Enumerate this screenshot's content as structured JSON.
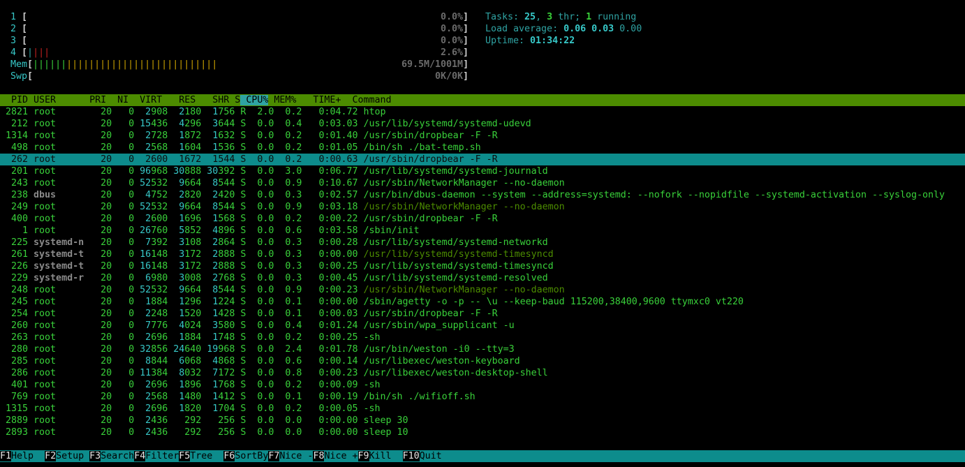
{
  "meters": {
    "cpus": [
      {
        "label": "1",
        "value": "0.0%",
        "bar": ""
      },
      {
        "label": "2",
        "value": "0.0%",
        "bar": ""
      },
      {
        "label": "3",
        "value": "0.0%",
        "bar": ""
      },
      {
        "label": "4",
        "value": "2.6%",
        "bar": "|||"
      }
    ],
    "mem": {
      "label": "Mem",
      "value": "69.5M/1001M",
      "bar_blue": "||||||",
      "bar_yellow": "|||||||||||||||||||||||||||"
    },
    "swp": {
      "label": "Swp",
      "value": "0K/0K"
    }
  },
  "summary": {
    "tasks_label": "Tasks: ",
    "tasks": "25",
    "thr": "3",
    "thr_label": " thr; ",
    "running": "1",
    "running_label": " running",
    "load_label": "Load average: ",
    "load1": "0.06",
    "load5": "0.03",
    "load15": "0.00",
    "uptime_label": "Uptime: ",
    "uptime": "01:34:22"
  },
  "header": {
    "pid": "  PID",
    "user": " USER     ",
    "pri": " PRI",
    "ni": "  NI",
    "virt": "  VIRT",
    "res": "   RES",
    "shr": "   SHR",
    "s": " S",
    "cpu": " CPU%",
    "mem": " MEM%",
    "time": "   TIME+ ",
    "command": " Command"
  },
  "processes": [
    {
      "pid": "2821",
      "user": "root",
      "pri": "20",
      "ni": "0",
      "virt": "2908",
      "res": "2180",
      "shr": "1756",
      "s": "R",
      "cpu": "2.0",
      "mem": "0.2",
      "time": "0:04.72",
      "command": "htop",
      "thread": false,
      "selected": false
    },
    {
      "pid": "212",
      "user": "root",
      "pri": "20",
      "ni": "0",
      "virt": "15436",
      "res": "4296",
      "shr": "3644",
      "s": "S",
      "cpu": "0.0",
      "mem": "0.4",
      "time": "0:03.03",
      "command": "/usr/lib/systemd/systemd-udevd",
      "thread": false,
      "selected": false
    },
    {
      "pid": "1314",
      "user": "root",
      "pri": "20",
      "ni": "0",
      "virt": "2728",
      "res": "1872",
      "shr": "1632",
      "s": "S",
      "cpu": "0.0",
      "mem": "0.2",
      "time": "0:01.40",
      "command": "/usr/sbin/dropbear -F -R",
      "thread": false,
      "selected": false
    },
    {
      "pid": "498",
      "user": "root",
      "pri": "20",
      "ni": "0",
      "virt": "2568",
      "res": "1604",
      "shr": "1536",
      "s": "S",
      "cpu": "0.0",
      "mem": "0.2",
      "time": "0:01.05",
      "command": "/bin/sh ./bat-temp.sh",
      "thread": false,
      "selected": false
    },
    {
      "pid": "262",
      "user": "root",
      "pri": "20",
      "ni": "0",
      "virt": "2600",
      "res": "1672",
      "shr": "1544",
      "s": "S",
      "cpu": "0.0",
      "mem": "0.2",
      "time": "0:00.63",
      "command": "/usr/sbin/dropbear -F -R",
      "thread": false,
      "selected": true
    },
    {
      "pid": "201",
      "user": "root",
      "pri": "20",
      "ni": "0",
      "virt": "96968",
      "res": "30888",
      "shr": "30392",
      "s": "S",
      "cpu": "0.0",
      "mem": "3.0",
      "time": "0:06.77",
      "command": "/usr/lib/systemd/systemd-journald",
      "thread": false,
      "selected": false
    },
    {
      "pid": "243",
      "user": "root",
      "pri": "20",
      "ni": "0",
      "virt": "52532",
      "res": "9664",
      "shr": "8544",
      "s": "S",
      "cpu": "0.0",
      "mem": "0.9",
      "time": "0:10.67",
      "command": "/usr/sbin/NetworkManager --no-daemon",
      "thread": false,
      "selected": false
    },
    {
      "pid": "238",
      "user": "dbus",
      "pri": "20",
      "ni": "0",
      "virt": "4752",
      "res": "2820",
      "shr": "2420",
      "s": "S",
      "cpu": "0.0",
      "mem": "0.3",
      "time": "0:02.57",
      "command": "/usr/bin/dbus-daemon --system --address=systemd: --nofork --nopidfile --systemd-activation --syslog-only",
      "thread": false,
      "selected": false
    },
    {
      "pid": "249",
      "user": "root",
      "pri": "20",
      "ni": "0",
      "virt": "52532",
      "res": "9664",
      "shr": "8544",
      "s": "S",
      "cpu": "0.0",
      "mem": "0.9",
      "time": "0:03.18",
      "command": "/usr/sbin/NetworkManager --no-daemon",
      "thread": true,
      "selected": false
    },
    {
      "pid": "400",
      "user": "root",
      "pri": "20",
      "ni": "0",
      "virt": "2600",
      "res": "1696",
      "shr": "1568",
      "s": "S",
      "cpu": "0.0",
      "mem": "0.2",
      "time": "0:00.22",
      "command": "/usr/sbin/dropbear -F -R",
      "thread": false,
      "selected": false
    },
    {
      "pid": "1",
      "user": "root",
      "pri": "20",
      "ni": "0",
      "virt": "26760",
      "res": "5852",
      "shr": "4896",
      "s": "S",
      "cpu": "0.0",
      "mem": "0.6",
      "time": "0:03.58",
      "command": "/sbin/init",
      "thread": false,
      "selected": false
    },
    {
      "pid": "225",
      "user": "systemd-n",
      "pri": "20",
      "ni": "0",
      "virt": "7392",
      "res": "3108",
      "shr": "2864",
      "s": "S",
      "cpu": "0.0",
      "mem": "0.3",
      "time": "0:00.28",
      "command": "/usr/lib/systemd/systemd-networkd",
      "thread": false,
      "selected": false
    },
    {
      "pid": "261",
      "user": "systemd-t",
      "pri": "20",
      "ni": "0",
      "virt": "16148",
      "res": "3172",
      "shr": "2888",
      "s": "S",
      "cpu": "0.0",
      "mem": "0.3",
      "time": "0:00.00",
      "command": "/usr/lib/systemd/systemd-timesyncd",
      "thread": true,
      "selected": false
    },
    {
      "pid": "226",
      "user": "systemd-t",
      "pri": "20",
      "ni": "0",
      "virt": "16148",
      "res": "3172",
      "shr": "2888",
      "s": "S",
      "cpu": "0.0",
      "mem": "0.3",
      "time": "0:00.25",
      "command": "/usr/lib/systemd/systemd-timesyncd",
      "thread": false,
      "selected": false
    },
    {
      "pid": "229",
      "user": "systemd-r",
      "pri": "20",
      "ni": "0",
      "virt": "6980",
      "res": "3008",
      "shr": "2768",
      "s": "S",
      "cpu": "0.0",
      "mem": "0.3",
      "time": "0:00.45",
      "command": "/usr/lib/systemd/systemd-resolved",
      "thread": false,
      "selected": false
    },
    {
      "pid": "248",
      "user": "root",
      "pri": "20",
      "ni": "0",
      "virt": "52532",
      "res": "9664",
      "shr": "8544",
      "s": "S",
      "cpu": "0.0",
      "mem": "0.9",
      "time": "0:00.23",
      "command": "/usr/sbin/NetworkManager --no-daemon",
      "thread": true,
      "selected": false
    },
    {
      "pid": "245",
      "user": "root",
      "pri": "20",
      "ni": "0",
      "virt": "1884",
      "res": "1296",
      "shr": "1224",
      "s": "S",
      "cpu": "0.0",
      "mem": "0.1",
      "time": "0:00.00",
      "command": "/sbin/agetty -o -p -- \\u --keep-baud 115200,38400,9600 ttymxc0 vt220",
      "thread": false,
      "selected": false
    },
    {
      "pid": "254",
      "user": "root",
      "pri": "20",
      "ni": "0",
      "virt": "2248",
      "res": "1520",
      "shr": "1428",
      "s": "S",
      "cpu": "0.0",
      "mem": "0.1",
      "time": "0:00.03",
      "command": "/usr/sbin/dropbear -F -R",
      "thread": false,
      "selected": false
    },
    {
      "pid": "260",
      "user": "root",
      "pri": "20",
      "ni": "0",
      "virt": "7776",
      "res": "4024",
      "shr": "3580",
      "s": "S",
      "cpu": "0.0",
      "mem": "0.4",
      "time": "0:01.24",
      "command": "/usr/sbin/wpa_supplicant -u",
      "thread": false,
      "selected": false
    },
    {
      "pid": "263",
      "user": "root",
      "pri": "20",
      "ni": "0",
      "virt": "2696",
      "res": "1884",
      "shr": "1748",
      "s": "S",
      "cpu": "0.0",
      "mem": "0.2",
      "time": "0:00.25",
      "command": "-sh",
      "thread": false,
      "selected": false
    },
    {
      "pid": "280",
      "user": "root",
      "pri": "20",
      "ni": "0",
      "virt": "32856",
      "res": "24640",
      "shr": "19968",
      "s": "S",
      "cpu": "0.0",
      "mem": "2.4",
      "time": "0:01.78",
      "command": "/usr/bin/weston -i0 --tty=3",
      "thread": false,
      "selected": false
    },
    {
      "pid": "285",
      "user": "root",
      "pri": "20",
      "ni": "0",
      "virt": "8844",
      "res": "6068",
      "shr": "4868",
      "s": "S",
      "cpu": "0.0",
      "mem": "0.6",
      "time": "0:00.14",
      "command": "/usr/libexec/weston-keyboard",
      "thread": false,
      "selected": false
    },
    {
      "pid": "286",
      "user": "root",
      "pri": "20",
      "ni": "0",
      "virt": "11384",
      "res": "8032",
      "shr": "7172",
      "s": "S",
      "cpu": "0.0",
      "mem": "0.8",
      "time": "0:00.23",
      "command": "/usr/libexec/weston-desktop-shell",
      "thread": false,
      "selected": false
    },
    {
      "pid": "401",
      "user": "root",
      "pri": "20",
      "ni": "0",
      "virt": "2696",
      "res": "1896",
      "shr": "1768",
      "s": "S",
      "cpu": "0.0",
      "mem": "0.2",
      "time": "0:00.09",
      "command": "-sh",
      "thread": false,
      "selected": false
    },
    {
      "pid": "769",
      "user": "root",
      "pri": "20",
      "ni": "0",
      "virt": "2568",
      "res": "1480",
      "shr": "1412",
      "s": "S",
      "cpu": "0.0",
      "mem": "0.1",
      "time": "0:00.19",
      "command": "/bin/sh ./wifioff.sh",
      "thread": false,
      "selected": false
    },
    {
      "pid": "1315",
      "user": "root",
      "pri": "20",
      "ni": "0",
      "virt": "2696",
      "res": "1820",
      "shr": "1704",
      "s": "S",
      "cpu": "0.0",
      "mem": "0.2",
      "time": "0:00.05",
      "command": "-sh",
      "thread": false,
      "selected": false
    },
    {
      "pid": "2889",
      "user": "root",
      "pri": "20",
      "ni": "0",
      "virt": "2436",
      "res": "292",
      "shr": "256",
      "s": "S",
      "cpu": "0.0",
      "mem": "0.0",
      "time": "0:00.00",
      "command": "sleep 30",
      "thread": false,
      "selected": false
    },
    {
      "pid": "2893",
      "user": "root",
      "pri": "20",
      "ni": "0",
      "virt": "2436",
      "res": "292",
      "shr": "256",
      "s": "S",
      "cpu": "0.0",
      "mem": "0.0",
      "time": "0:00.00",
      "command": "sleep 10",
      "thread": false,
      "selected": false
    }
  ],
  "function_keys": [
    {
      "key": "F1",
      "label": "Help  "
    },
    {
      "key": "F2",
      "label": "Setup "
    },
    {
      "key": "F3",
      "label": "Search"
    },
    {
      "key": "F4",
      "label": "Filter"
    },
    {
      "key": "F5",
      "label": "Tree  "
    },
    {
      "key": "F6",
      "label": "SortBy"
    },
    {
      "key": "F7",
      "label": "Nice -"
    },
    {
      "key": "F8",
      "label": "Nice +"
    },
    {
      "key": "F9",
      "label": "Kill  "
    },
    {
      "key": "F10",
      "label": "Quit"
    }
  ],
  "colors": {
    "background": "#000000",
    "text_green": "#39d13a",
    "header_bg": "#4c8c00",
    "selected_bg": "#0d8c8c",
    "cyan": "#37c8c8",
    "thread_green": "#4c8c00"
  }
}
